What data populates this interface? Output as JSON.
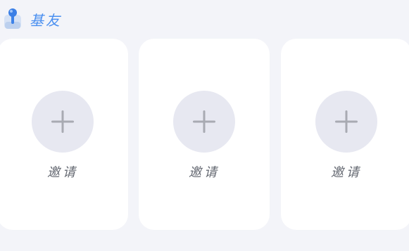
{
  "header": {
    "title": "基友",
    "icon": "joystick-icon"
  },
  "slots": [
    {
      "label": "邀请",
      "icon": "plus-icon"
    },
    {
      "label": "邀请",
      "icon": "plus-icon"
    },
    {
      "label": "邀请",
      "icon": "plus-icon"
    }
  ],
  "colors": {
    "background": "#f3f4f9",
    "card": "#ffffff",
    "circle": "#e7e8f1",
    "plus": "#a8aab2",
    "title": "#4a8ff0",
    "label": "#666a73"
  }
}
